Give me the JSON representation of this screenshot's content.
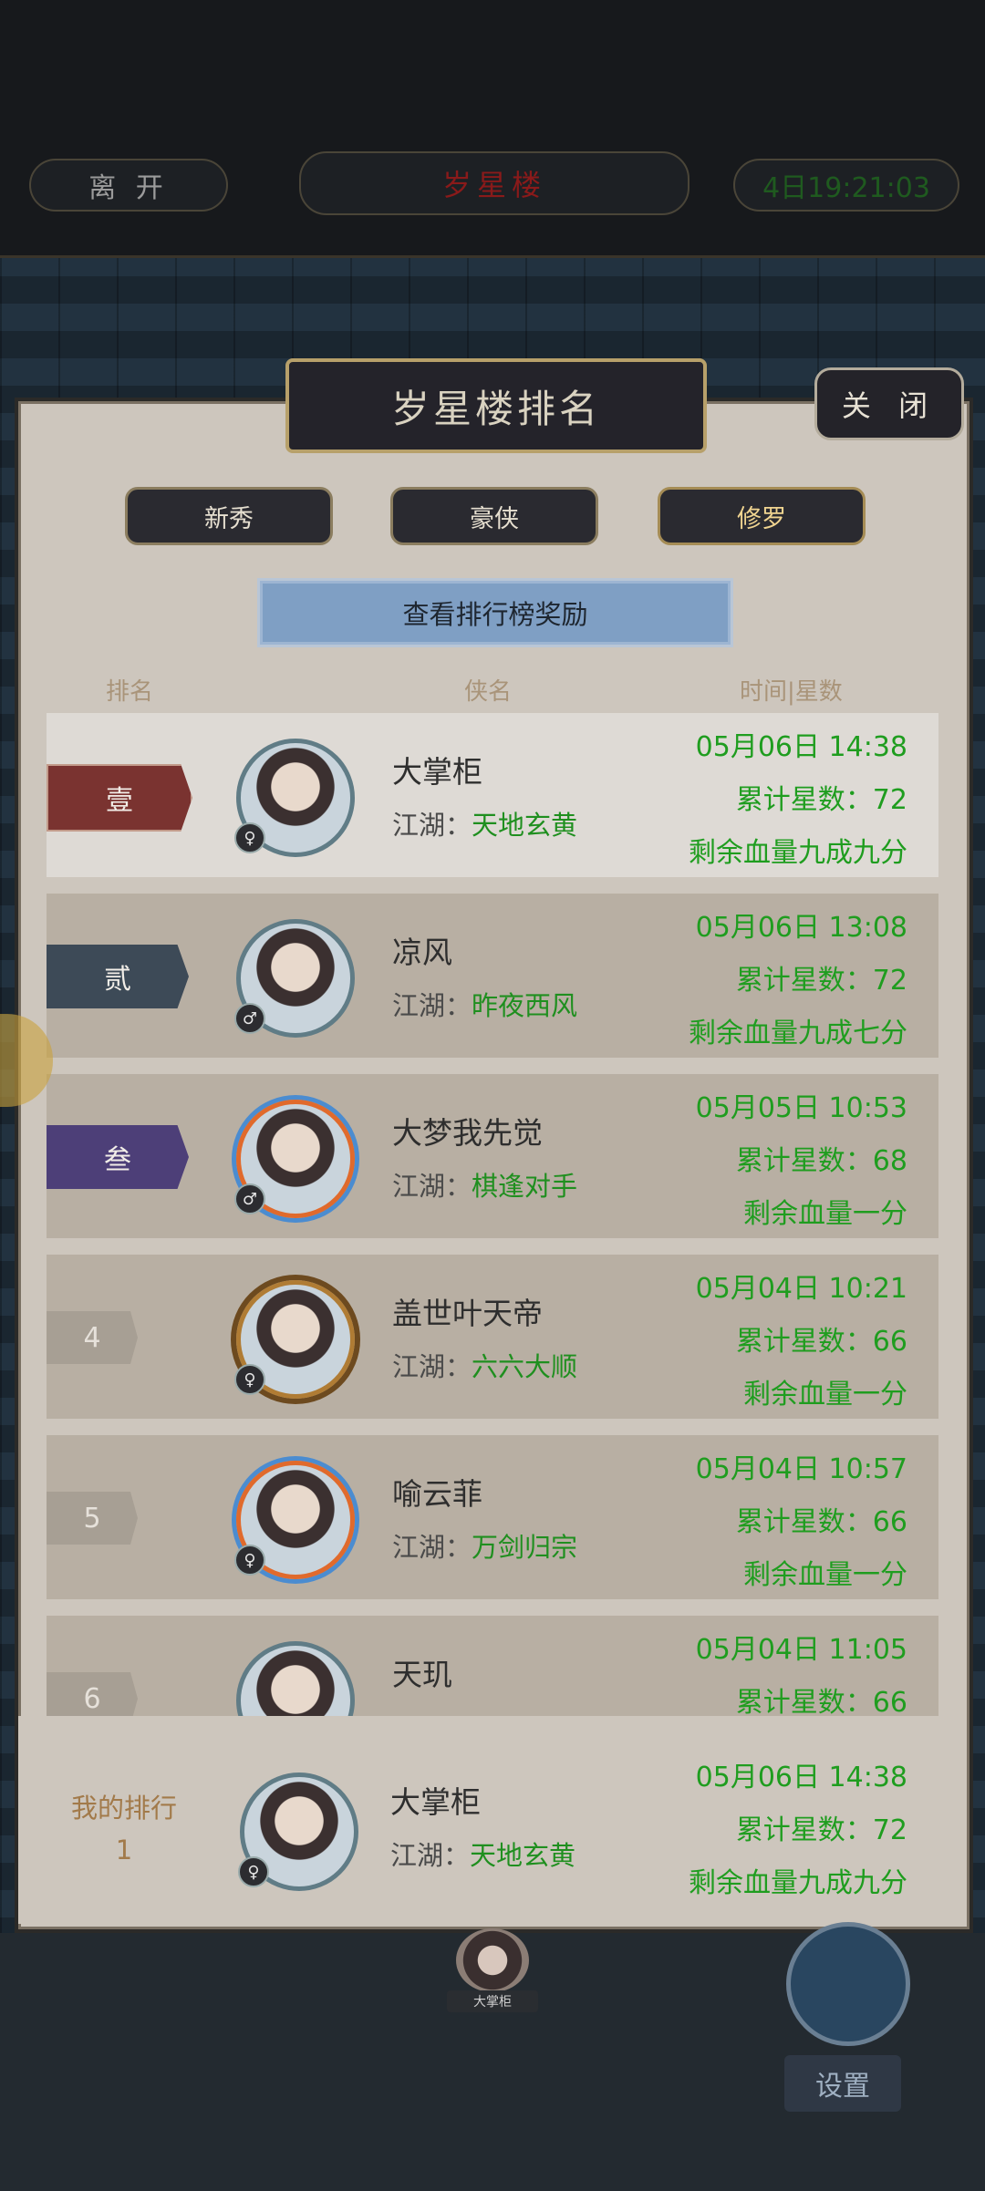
{
  "top": {
    "leave": "离 开",
    "title": "岁星楼",
    "time": "4日19:21:03"
  },
  "panel": {
    "title": "岁星楼排名",
    "close": "关 闭",
    "tabs": [
      "新秀",
      "豪侠",
      "修罗"
    ],
    "reward_button": "查看排行榜奖励",
    "columns": {
      "rank": "排名",
      "name": "侠名",
      "time_stars": "时间|星数"
    }
  },
  "guild_prefix": "江湖：",
  "rows": [
    {
      "rank": "壹",
      "name": "大掌柜",
      "guild": "天地玄黄",
      "time": "05月06日 14:38",
      "stars": "累计星数：72",
      "hp": "剩余血量九成九分",
      "sex": "♀"
    },
    {
      "rank": "贰",
      "name": "凉风",
      "guild": "昨夜西风",
      "time": "05月06日 13:08",
      "stars": "累计星数：72",
      "hp": "剩余血量九成七分",
      "sex": "♂"
    },
    {
      "rank": "叁",
      "name": "大梦我先觉",
      "guild": "棋逢对手",
      "time": "05月05日 10:53",
      "stars": "累计星数：68",
      "hp": "剩余血量一分",
      "sex": "♂"
    },
    {
      "rank": "4",
      "name": "盖世叶天帝",
      "guild": "六六大顺",
      "time": "05月04日 10:21",
      "stars": "累计星数：66",
      "hp": "剩余血量一分",
      "sex": "♀"
    },
    {
      "rank": "5",
      "name": "喻云菲",
      "guild": "万剑归宗",
      "time": "05月04日 10:57",
      "stars": "累计星数：66",
      "hp": "剩余血量一分",
      "sex": "♀"
    },
    {
      "rank": "6",
      "name": "天玑",
      "guild": "",
      "time": "05月04日 11:05",
      "stars": "累计星数：66",
      "hp": "",
      "sex": ""
    }
  ],
  "my_rank": {
    "label": "我的排行",
    "value": "1",
    "name": "大掌柜",
    "guild": "天地玄黄",
    "time": "05月06日 14:38",
    "stars": "累计星数：72",
    "hp": "剩余血量九成九分",
    "sex": "♀"
  },
  "bottom": {
    "mini_label": "大掌柜",
    "settings": "设置"
  }
}
